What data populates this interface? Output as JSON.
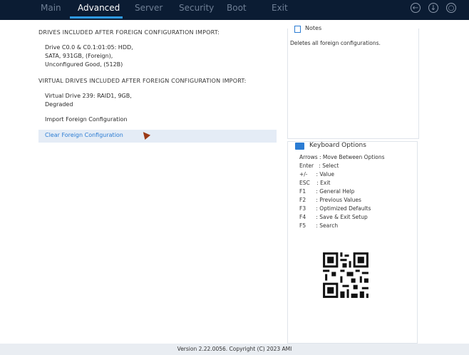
{
  "tabs": [
    "Main",
    "Advanced",
    "Server",
    "Security",
    "Boot",
    "Exit"
  ],
  "icons": [
    "back-icon",
    "download-icon",
    "search-icon"
  ],
  "left": {
    "drives_header": "DRIVES INCLUDED AFTER FOREIGN CONFIGURATION IMPORT:",
    "drive_line1": "Drive C0.0 & C0.1:01:05: HDD,",
    "drive_line2": "SATA, 931GB, (Foreign),",
    "drive_line3": "Unconfigured Good, (512B)",
    "vd_header": "VIRTUAL DRIVES INCLUDED AFTER FOREIGN CONFIGURATION IMPORT:",
    "vd_line1": "Virtual Drive 239: RAID1, 9GB,",
    "vd_line2": "Degraded",
    "import_label": "Import Foreign Configuration",
    "clear_label": "Clear Foreign Configuration"
  },
  "notes": {
    "title": "Notes",
    "text": "Deletes all foreign configurations."
  },
  "keyboard": {
    "title": "Keyboard Options",
    "lines": [
      "Arrows : Move Between Options",
      "Enter   : Select",
      "+/-     : Value",
      "ESC    : Exit",
      "F1      : General Help",
      "F2      : Previous Values",
      "F3      : Optimized Defaults",
      "F4      : Save & Exit Setup",
      "F5      : Search"
    ]
  },
  "footer": "Version 2.22.0056. Copyright (C) 2023 AMI",
  "colors": {
    "topbar": "#0b1c33",
    "accent": "#2b7cd3",
    "selection_bg": "#e4ecf6",
    "cursor": "#9b3a16"
  }
}
